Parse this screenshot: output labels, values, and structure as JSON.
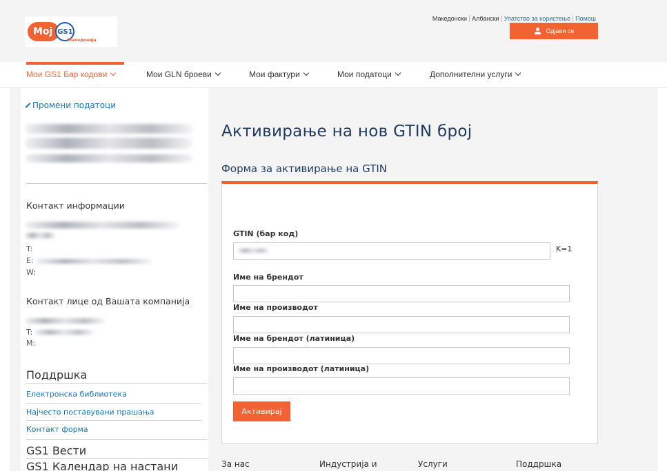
{
  "header": {
    "logo": {
      "moj": "Мој",
      "gs1": "GS1",
      "sub": "Македонија"
    },
    "links": [
      "Македонски",
      "Албански",
      "Упатство за користење",
      "Помош"
    ],
    "logout_label": "Одјави се"
  },
  "nav": {
    "items": [
      {
        "label": "Мои GS1 Бар кодови"
      },
      {
        "label": "Мои GLN броеви"
      },
      {
        "label": "Мои фактури"
      },
      {
        "label": "Мои податоци"
      },
      {
        "label": "Дополнителни услуги"
      }
    ]
  },
  "sidebar": {
    "edit_link": "Промени податоци",
    "contact_heading": "Контакт информации",
    "contact_t": "T:",
    "contact_e": "E:",
    "contact_w": "W:",
    "company_contact_heading": "Контакт лице од Вашата компанија",
    "company_t": "T:",
    "company_m": "M:",
    "support_heading": "Поддршка",
    "support_links": [
      "Електронска библиотека",
      "Најчесто поставувани прашања",
      "Контакт форма"
    ],
    "news_heading": "GS1 Вести",
    "calendar_heading": "GS1 Календар на настани"
  },
  "main": {
    "page_title": "Активирање на нов GTIN број",
    "form_title": "Форма за активирање на GTIN",
    "fields": {
      "gtin_label": "GTIN (бар код)",
      "gtin_k": "K=1",
      "brand_label": "Име на брендот",
      "product_label": "Име на производот",
      "brand_latin_label": "Име на брендот (латиница)",
      "product_latin_label": "Име на производот (латиница)"
    },
    "activate_label": "Активирај"
  },
  "footer": {
    "items": [
      "За нас",
      "Индустрија и",
      "Услуги",
      "Поддршка"
    ]
  },
  "colors": {
    "accent": "#f26334",
    "link": "#1a73b5",
    "title": "#1f3a5f"
  }
}
